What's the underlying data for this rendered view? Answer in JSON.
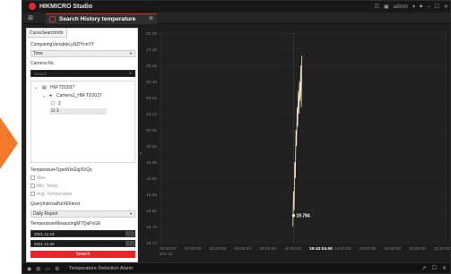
{
  "app": {
    "brand": "HIKMICRO Studio",
    "tab_title": "Search History temperature",
    "user": "admin",
    "user_caret": "▾",
    "titlebar_icons": [
      "grid-icon",
      "monitor-icon",
      "lock-icon",
      "minimize-icon",
      "maximize-icon",
      "close-icon"
    ]
  },
  "left_panel": {
    "tab_label": "CurveSearchInfo",
    "comparing_label": "ComparingVariableLyNZfYnnYY",
    "comparing_value": "Time",
    "camera_label": "Camera No.",
    "search_placeholder": "Search",
    "tree": {
      "root": "HM-TD2037",
      "camera": "Camera1_HM-TD2037",
      "child_2": "2",
      "child_1": "1"
    },
    "temp_type_label": "TemperatureTypeWIsGIgSVQs",
    "checkboxes": [
      "Max.",
      "Min. Temp.",
      "Avg. Temperature"
    ],
    "interval_label": "QueryIntervalNzXEhtersl",
    "interval_value": "Daily Report",
    "time_label": "TemperatureMeasuringMTQaPoG8",
    "date_start": "2021.12.18",
    "date_end": "2021.12.20",
    "search_button": "Search"
  },
  "chart_data": {
    "type": "line",
    "y_ticks": [
      "20.35",
      "20.30",
      "20.25",
      "20.20",
      "20.15",
      "20.10",
      "20.05",
      "20.00",
      "19.95",
      "19.90",
      "19.85",
      "19.80",
      "19.75",
      "19.70"
    ],
    "ylim": [
      19.7,
      20.35
    ],
    "x_ticks": [
      "00:00:00\nDec 20",
      "02:00:00",
      "04:00:00",
      "06:00:00",
      "08:00:00",
      "10:00:00",
      "19:43:04.00",
      "14:00:00",
      "16:00:00",
      "18:00:00",
      "20:00:00",
      "22:00:00"
    ],
    "xlim": [
      0,
      24
    ],
    "cursor_x": 11.2,
    "cursor_label": "19:43:04.00",
    "series": [
      {
        "color": "#f0e2c4",
        "x": [
          11.15,
          11.2,
          11.25,
          11.3,
          11.35,
          11.4,
          11.45,
          11.5,
          11.55,
          11.6,
          11.65,
          11.7,
          11.75,
          11.8,
          11.85,
          11.9
        ],
        "y": [
          19.75,
          19.86,
          19.8,
          19.95,
          19.9,
          20.05,
          20.0,
          20.12,
          20.06,
          20.17,
          20.1,
          20.2,
          20.14,
          20.25,
          20.12,
          20.28
        ]
      }
    ],
    "point_label": "19.784",
    "point_value": 19.784
  },
  "statusbar": {
    "text": "Temperature Detection Alarm"
  }
}
